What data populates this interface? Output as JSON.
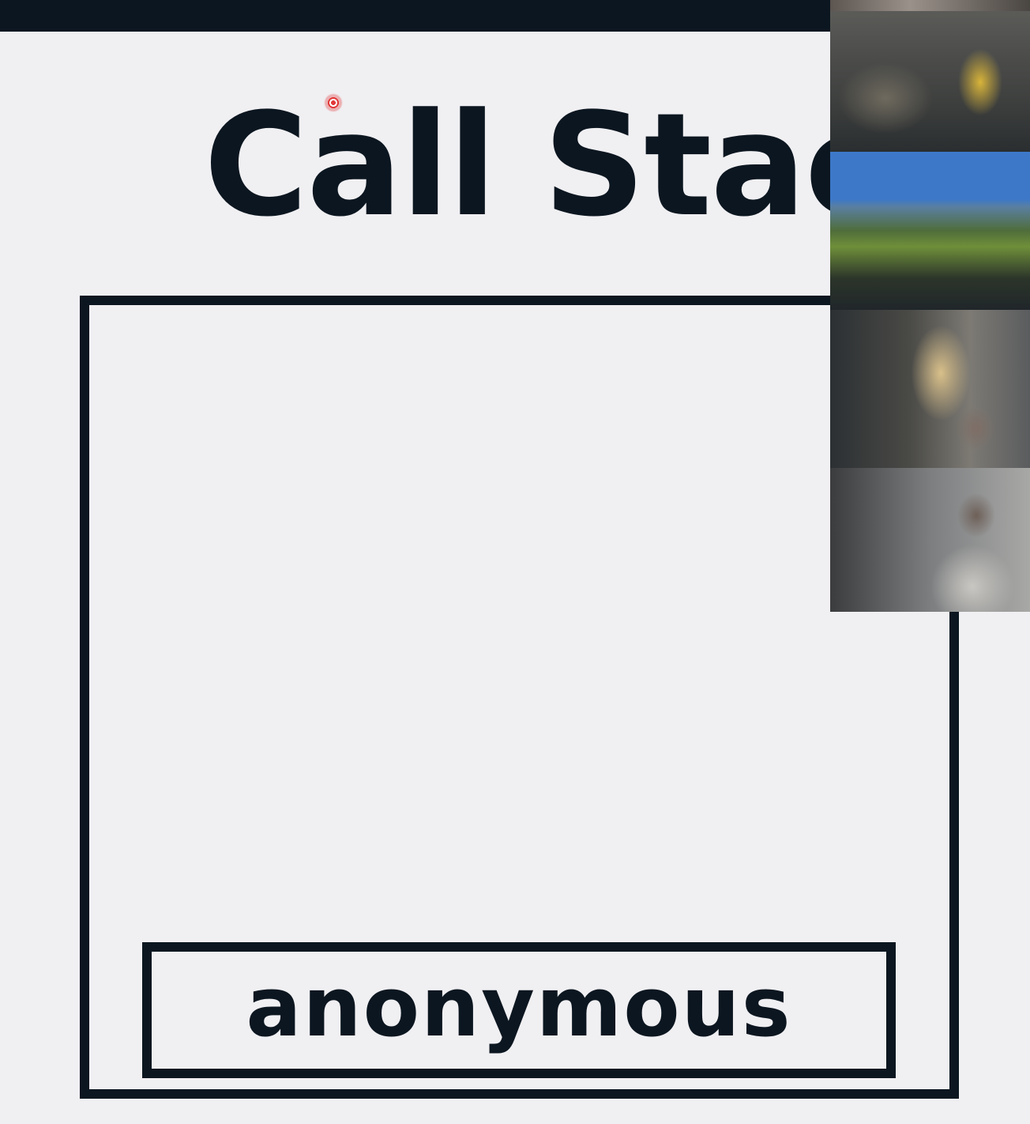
{
  "slide": {
    "title": "Call Stack",
    "call_stack": {
      "frames": [
        {
          "label": "anonymous"
        }
      ]
    }
  },
  "colors": {
    "slide_background": "#f0eff2",
    "ink": "#0b1620",
    "laser_pointer": "#e23a3a"
  }
}
